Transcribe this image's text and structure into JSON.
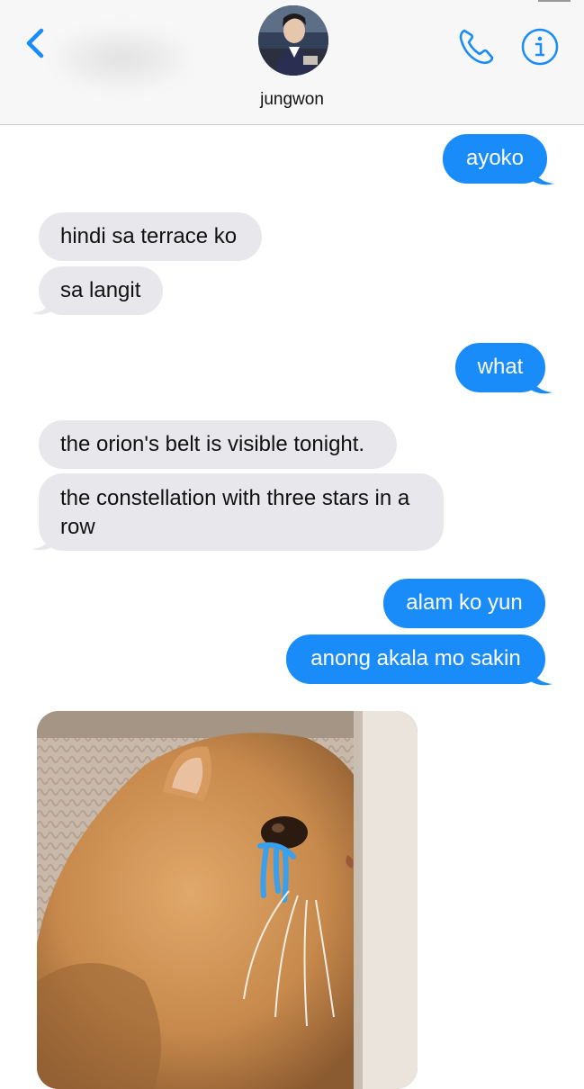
{
  "header": {
    "contact_name": "jungwon",
    "back_icon": "chevron-left-icon",
    "call_icon": "phone-icon",
    "info_icon": "info-icon",
    "accent_color": "#1a8cf9"
  },
  "messages": [
    {
      "direction": "sent",
      "text": "ayoko"
    },
    {
      "direction": "received",
      "text": "hindi sa terrace ko"
    },
    {
      "direction": "received",
      "text": "sa langit"
    },
    {
      "direction": "sent",
      "text": "what"
    },
    {
      "direction": "received",
      "text": "the orion's belt is visible tonight."
    },
    {
      "direction": "received",
      "text": "the constellation with three stars in a row"
    },
    {
      "direction": "sent",
      "text": "alam ko yun"
    },
    {
      "direction": "sent",
      "text": "anong akala mo sakin"
    },
    {
      "direction": "received",
      "type": "image",
      "description_icon": "crying-cat-image"
    }
  ],
  "colors": {
    "sent_bubble": "#1a8cf9",
    "received_bubble": "#e8e8ec"
  }
}
